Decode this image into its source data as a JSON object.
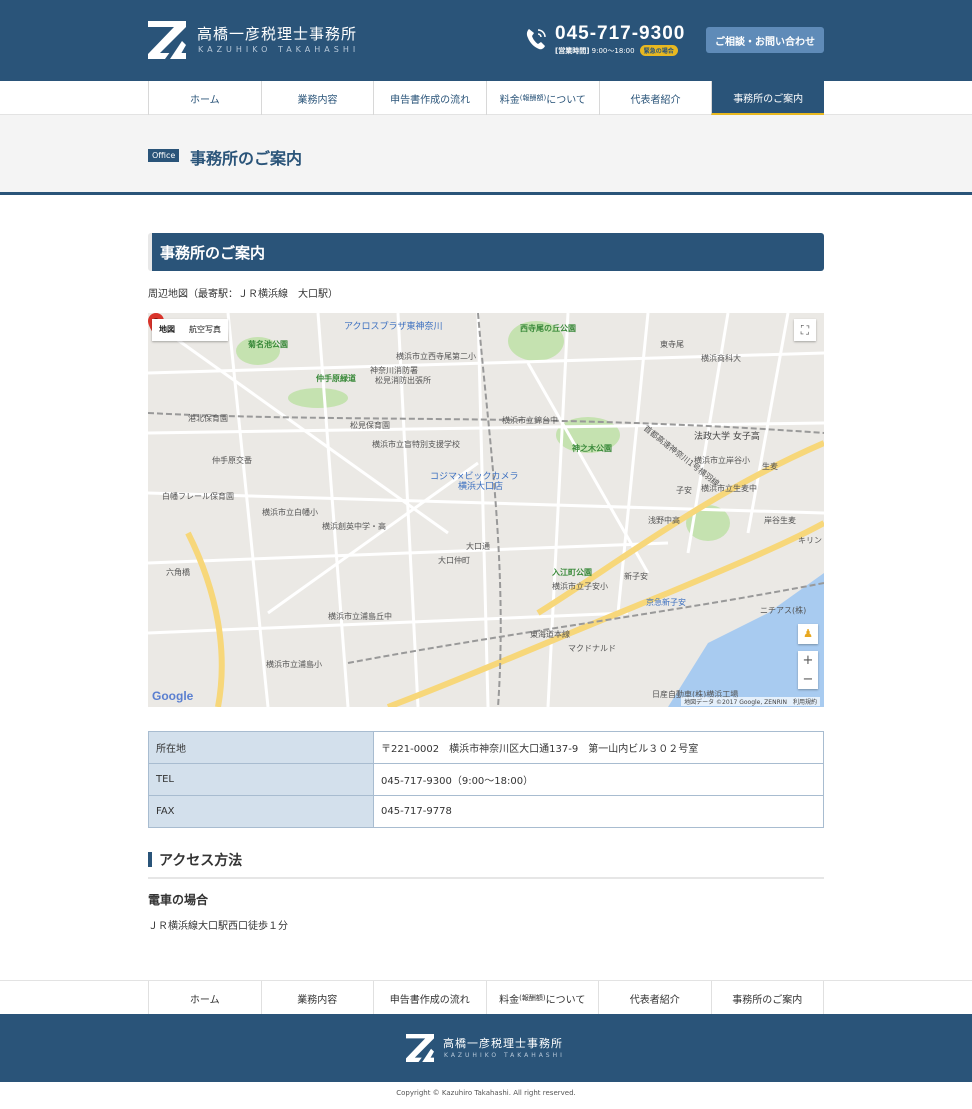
{
  "brand": {
    "name": "高橋一彦税理士事務所",
    "sub": "KAZUHIKO TAKAHASHI"
  },
  "header": {
    "phone": "045-717-9300",
    "hours_label": "[営業時間]",
    "hours": "9:00～18:00",
    "urgent": "緊急の場合",
    "contact_label": "ご相談・お問い合わせ"
  },
  "nav": [
    {
      "label": "ホーム"
    },
    {
      "label": "業務内容"
    },
    {
      "label": "申告書作成の流れ"
    },
    {
      "label_a": "料金",
      "label_b": "(報酬額)",
      "label_c": "について"
    },
    {
      "label": "代表者紹介"
    },
    {
      "label": "事務所のご案内"
    }
  ],
  "page": {
    "tag": "Office",
    "title": "事務所のご案内"
  },
  "section": {
    "title": "事務所のご案内",
    "map_caption": "周辺地図（最寄駅：ＪＲ横浜線　大口駅）"
  },
  "map": {
    "type_map": "地図",
    "type_sat": "航空写真",
    "fullscreen": "⛶",
    "pegman": "♟",
    "zoom_in": "+",
    "zoom_out": "−",
    "google": "Google",
    "attrib": "地図データ ©2017 Google, ZENRIN　利用規約",
    "colors": {
      "road_major": "#f7d77a",
      "road": "#ffffff",
      "park": "#c5e2b0",
      "water": "#a8cbf0",
      "rail": "#999999",
      "pin": "#d9342b"
    },
    "labels": [
      "アクロスプラザ東神奈川",
      "西寺尾の丘公園",
      "菊名池公園",
      "仲手原緑道",
      "神奈川消防署",
      "松見消防出張所",
      "横浜市立西寺尾第二小",
      "松見保育園",
      "横浜市立錦台中",
      "横浜市立盲特別支援学校",
      "神之木公園",
      "法政大学 女子高",
      "コジマ×ビックカメラ",
      "横浜大口店",
      "白幡フレール保育園",
      "横浜市立白幡小",
      "横浜創英中学・高",
      "大口通",
      "大口仲町",
      "入江町公園",
      "横浜市立子安小",
      "横浜市立浦島丘中",
      "横浜市立浦島小",
      "マクドナルド",
      "日産自動車(株)横浜工場",
      "浅野中高",
      "横浜市立岸谷小",
      "横浜市立生麦中",
      "東海道本線",
      "首都高速神奈川1号横羽線",
      "子安",
      "新子安",
      "京急新子安",
      "六角橋",
      "港北保育園",
      "仲手原交番",
      "東寺尾",
      "横浜商科大",
      "生麦",
      "岸谷生麦",
      "キリン",
      "ニチアス(株)"
    ]
  },
  "table": [
    {
      "head": "所在地",
      "value": "〒221-0002　横浜市神奈川区大口通137-9　第一山内ビル３０２号室"
    },
    {
      "head": "TEL",
      "value": "045-717-9300（9:00～18:00）"
    },
    {
      "head": "FAX",
      "value": "045-717-9778"
    }
  ],
  "access": {
    "title": "アクセス方法",
    "train_head": "電車の場合",
    "train_text": "ＪＲ横浜線大口駅西口徒歩１分"
  },
  "footer_nav": [
    {
      "label": "ホーム"
    },
    {
      "label": "業務内容"
    },
    {
      "label": "申告書作成の流れ"
    },
    {
      "label_a": "料金",
      "label_b": "(報酬額)",
      "label_c": "について"
    },
    {
      "label": "代表者紹介"
    },
    {
      "label": "事務所のご案内"
    }
  ],
  "footer": {
    "copyright": "Copyright © Kazuhiro Takahashi. All right reserved."
  }
}
